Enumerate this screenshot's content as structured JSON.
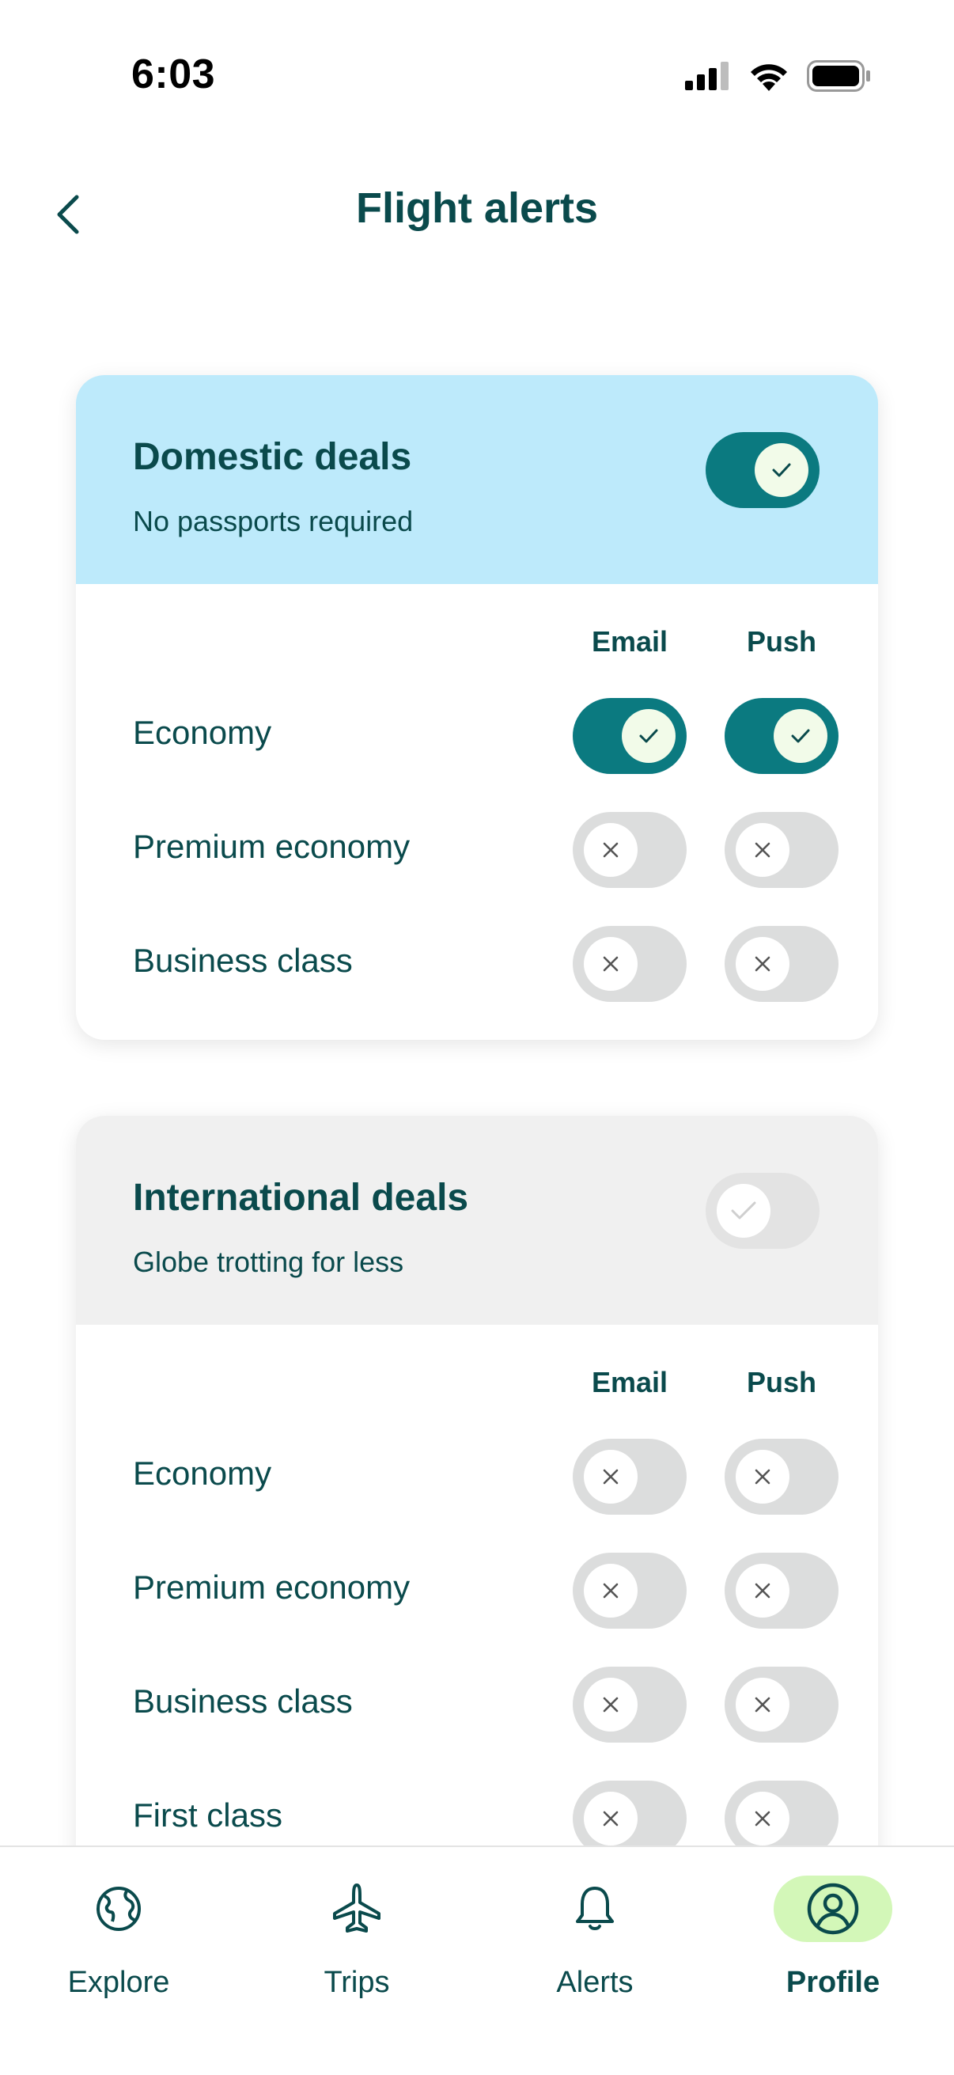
{
  "status_bar": {
    "time": "6:03"
  },
  "header": {
    "title": "Flight alerts",
    "back_icon": "chevron-left-icon"
  },
  "colors": {
    "accent": "#0b7a80",
    "domestic_header_bg": "#bdeafb",
    "international_header_bg": "#f0f0f0",
    "active_tab_bg": "#d3f7b8",
    "text": "#0a4a4c"
  },
  "domestic": {
    "title": "Domestic deals",
    "subtitle": "No passports required",
    "enabled": true,
    "email_label": "Email",
    "push_label": "Push",
    "rows": [
      {
        "label": "Economy",
        "email": true,
        "push": true
      },
      {
        "label": "Premium economy",
        "email": false,
        "push": false
      },
      {
        "label": "Business class",
        "email": false,
        "push": false
      }
    ]
  },
  "international": {
    "title": "International deals",
    "subtitle": "Globe trotting for less",
    "enabled": false,
    "email_label": "Email",
    "push_label": "Push",
    "rows": [
      {
        "label": "Economy",
        "email": false,
        "push": false
      },
      {
        "label": "Premium economy",
        "email": false,
        "push": false
      },
      {
        "label": "Business class",
        "email": false,
        "push": false
      },
      {
        "label": "First class",
        "email": false,
        "push": false
      }
    ]
  },
  "tab_bar": {
    "tabs": [
      {
        "label": "Explore",
        "icon": "globe-icon",
        "active": false
      },
      {
        "label": "Trips",
        "icon": "airplane-icon",
        "active": false
      },
      {
        "label": "Alerts",
        "icon": "bell-icon",
        "active": false
      },
      {
        "label": "Profile",
        "icon": "user-circle-icon",
        "active": true
      }
    ]
  }
}
